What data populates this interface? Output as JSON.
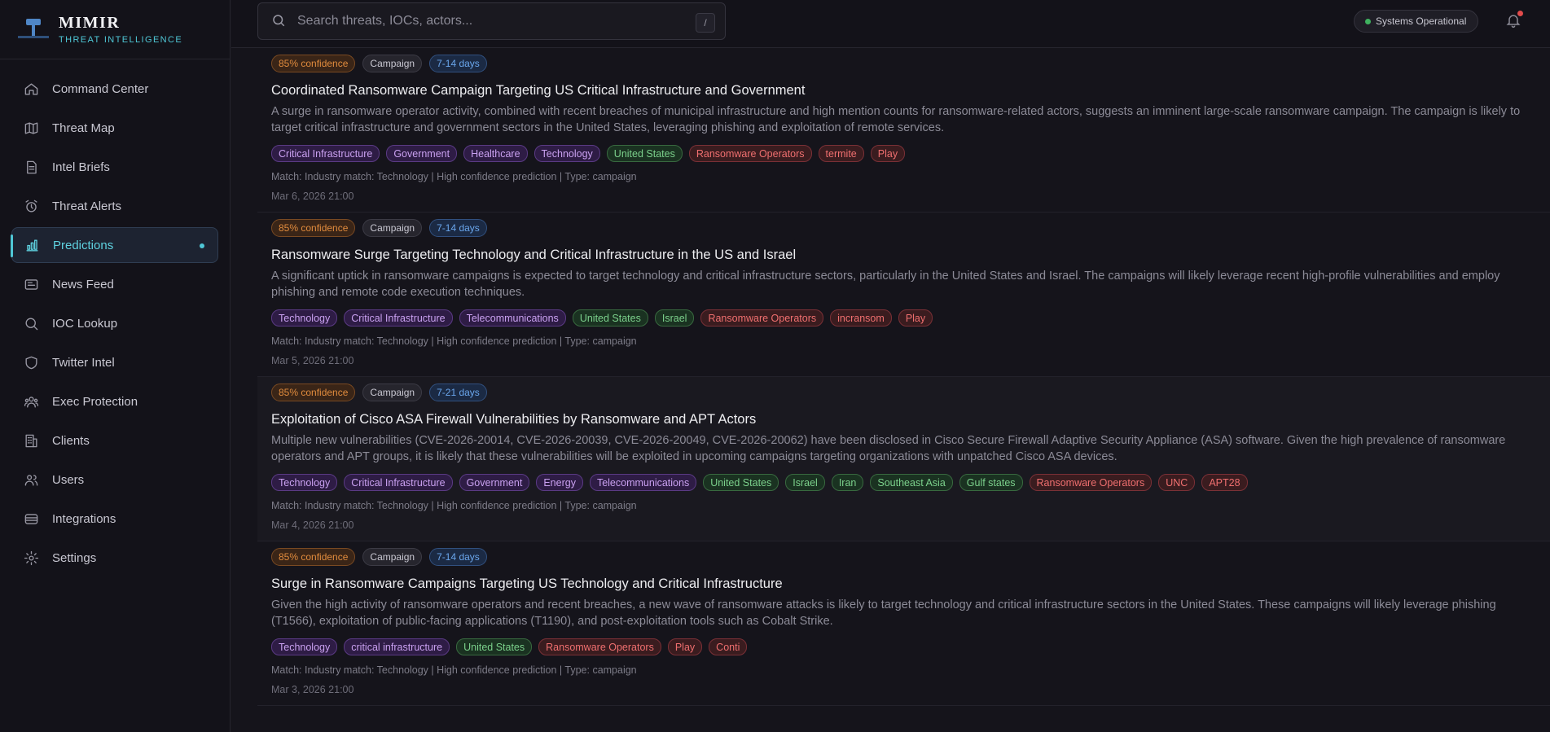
{
  "brand": {
    "name": "MIMIR",
    "subtitle": "THREAT INTELLIGENCE"
  },
  "sidebar": {
    "items": [
      {
        "label": "Command Center",
        "icon": "home-icon"
      },
      {
        "label": "Threat Map",
        "icon": "map-icon"
      },
      {
        "label": "Intel Briefs",
        "icon": "document-icon"
      },
      {
        "label": "Threat Alerts",
        "icon": "alarm-icon"
      },
      {
        "label": "Predictions",
        "icon": "bar-chart-icon",
        "active": true
      },
      {
        "label": "News Feed",
        "icon": "newspaper-icon"
      },
      {
        "label": "IOC Lookup",
        "icon": "search-icon"
      },
      {
        "label": "Twitter Intel",
        "icon": "shield-icon"
      },
      {
        "label": "Exec Protection",
        "icon": "people-group-icon"
      },
      {
        "label": "Clients",
        "icon": "building-icon"
      },
      {
        "label": "Users",
        "icon": "users-icon"
      },
      {
        "label": "Integrations",
        "icon": "database-icon"
      },
      {
        "label": "Settings",
        "icon": "gear-icon"
      }
    ]
  },
  "topbar": {
    "search_placeholder": "Search threats, IOCs, actors...",
    "shortcut": "/",
    "status": "Systems Operational"
  },
  "predictions": [
    {
      "confidence": "85% confidence",
      "kind": "Campaign",
      "window": "7-14 days",
      "title": "Coordinated Ransomware Campaign Targeting US Critical Infrastructure and Government",
      "description": "A surge in ransomware operator activity, combined with recent breaches of municipal infrastructure and high mention counts for ransomware-related actors, suggests an imminent large-scale ransomware campaign. The campaign is likely to target critical infrastructure and government sectors in the United States, leveraging phishing and exploitation of remote services.",
      "tags": [
        {
          "text": "Critical Infrastructure",
          "type": "industry"
        },
        {
          "text": "Government",
          "type": "industry"
        },
        {
          "text": "Healthcare",
          "type": "industry"
        },
        {
          "text": "Technology",
          "type": "industry"
        },
        {
          "text": "United States",
          "type": "geo"
        },
        {
          "text": "Ransomware Operators",
          "type": "actor"
        },
        {
          "text": "termite",
          "type": "actor"
        },
        {
          "text": "Play",
          "type": "actor"
        }
      ],
      "match": "Match: Industry match: Technology | High confidence prediction | Type: campaign",
      "date": "Mar 6, 2026 21:00"
    },
    {
      "confidence": "85% confidence",
      "kind": "Campaign",
      "window": "7-14 days",
      "title": "Ransomware Surge Targeting Technology and Critical Infrastructure in the US and Israel",
      "description": "A significant uptick in ransomware campaigns is expected to target technology and critical infrastructure sectors, particularly in the United States and Israel. The campaigns will likely leverage recent high-profile vulnerabilities and employ phishing and remote code execution techniques.",
      "tags": [
        {
          "text": "Technology",
          "type": "industry"
        },
        {
          "text": "Critical Infrastructure",
          "type": "industry"
        },
        {
          "text": "Telecommunications",
          "type": "industry"
        },
        {
          "text": "United States",
          "type": "geo"
        },
        {
          "text": "Israel",
          "type": "geo"
        },
        {
          "text": "Ransomware Operators",
          "type": "actor"
        },
        {
          "text": "incransom",
          "type": "actor"
        },
        {
          "text": "Play",
          "type": "actor"
        }
      ],
      "match": "Match: Industry match: Technology | High confidence prediction | Type: campaign",
      "date": "Mar 5, 2026 21:00"
    },
    {
      "confidence": "85% confidence",
      "kind": "Campaign",
      "window": "7-21 days",
      "title": "Exploitation of Cisco ASA Firewall Vulnerabilities by Ransomware and APT Actors",
      "description": "Multiple new vulnerabilities (CVE-2026-20014, CVE-2026-20039, CVE-2026-20049, CVE-2026-20062) have been disclosed in Cisco Secure Firewall Adaptive Security Appliance (ASA) software. Given the high prevalence of ransomware operators and APT groups, it is likely that these vulnerabilities will be exploited in upcoming campaigns targeting organizations with unpatched Cisco ASA devices.",
      "tags": [
        {
          "text": "Technology",
          "type": "industry"
        },
        {
          "text": "Critical Infrastructure",
          "type": "industry"
        },
        {
          "text": "Government",
          "type": "industry"
        },
        {
          "text": "Energy",
          "type": "industry"
        },
        {
          "text": "Telecommunications",
          "type": "industry"
        },
        {
          "text": "United States",
          "type": "geo"
        },
        {
          "text": "Israel",
          "type": "geo"
        },
        {
          "text": "Iran",
          "type": "geo"
        },
        {
          "text": "Southeast Asia",
          "type": "geo"
        },
        {
          "text": "Gulf states",
          "type": "geo"
        },
        {
          "text": "Ransomware Operators",
          "type": "actor"
        },
        {
          "text": "UNC",
          "type": "actor"
        },
        {
          "text": "APT28",
          "type": "actor"
        }
      ],
      "match": "Match: Industry match: Technology | High confidence prediction | Type: campaign",
      "date": "Mar 4, 2026 21:00"
    },
    {
      "confidence": "85% confidence",
      "kind": "Campaign",
      "window": "7-14 days",
      "title": "Surge in Ransomware Campaigns Targeting US Technology and Critical Infrastructure",
      "description": "Given the high activity of ransomware operators and recent breaches, a new wave of ransomware attacks is likely to target technology and critical infrastructure sectors in the United States. These campaigns will likely leverage phishing (T1566), exploitation of public-facing applications (T1190), and post-exploitation tools such as Cobalt Strike.",
      "tags": [
        {
          "text": "Technology",
          "type": "industry"
        },
        {
          "text": "critical infrastructure",
          "type": "industry"
        },
        {
          "text": "United States",
          "type": "geo"
        },
        {
          "text": "Ransomware Operators",
          "type": "actor"
        },
        {
          "text": "Play",
          "type": "actor"
        },
        {
          "text": "Conti",
          "type": "actor"
        }
      ],
      "match": "Match: Industry match: Technology | High confidence prediction | Type: campaign",
      "date": "Mar 3, 2026 21:00"
    }
  ]
}
